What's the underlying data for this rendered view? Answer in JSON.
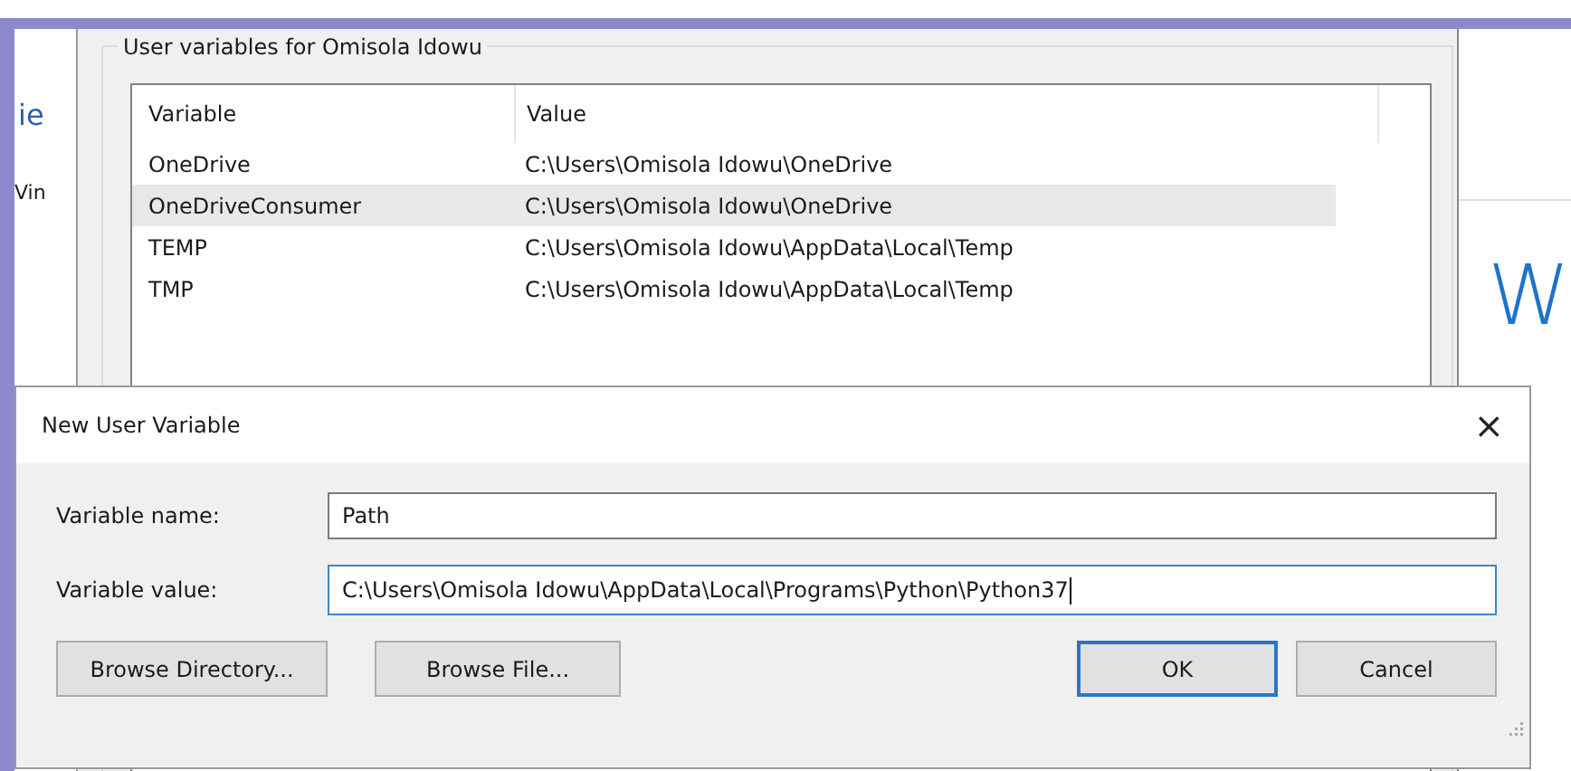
{
  "background_left": {
    "texts": [
      "ie",
      "Vin"
    ]
  },
  "background_right": {
    "text": "W"
  },
  "environment_dialog": {
    "group_title": "User variables for Omisola Idowu",
    "table": {
      "columns": [
        "Variable",
        "Value"
      ],
      "rows": [
        {
          "variable": "OneDrive",
          "value": "C:\\Users\\Omisola Idowu\\OneDrive",
          "selected": false
        },
        {
          "variable": "OneDriveConsumer",
          "value": "C:\\Users\\Omisola Idowu\\OneDrive",
          "selected": true
        },
        {
          "variable": "TEMP",
          "value": "C:\\Users\\Omisola Idowu\\AppData\\Local\\Temp",
          "selected": false
        },
        {
          "variable": "TMP",
          "value": "C:\\Users\\Omisola Idowu\\AppData\\Local\\Temp",
          "selected": false
        }
      ]
    }
  },
  "dialog": {
    "title": "New User Variable",
    "close": "×",
    "fields": [
      {
        "label": "Variable name:",
        "value": "Path",
        "focused": false
      },
      {
        "label": "Variable value:",
        "value": "C:\\Users\\Omisola Idowu\\AppData\\Local\\Programs\\Python\\Python37",
        "focused": true
      }
    ],
    "left_buttons": [
      {
        "label": "Browse Directory...",
        "default": false
      },
      {
        "label": "Browse File...",
        "default": false
      }
    ],
    "right_buttons": [
      {
        "label": "OK",
        "default": true
      },
      {
        "label": "Cancel",
        "default": false
      }
    ]
  }
}
